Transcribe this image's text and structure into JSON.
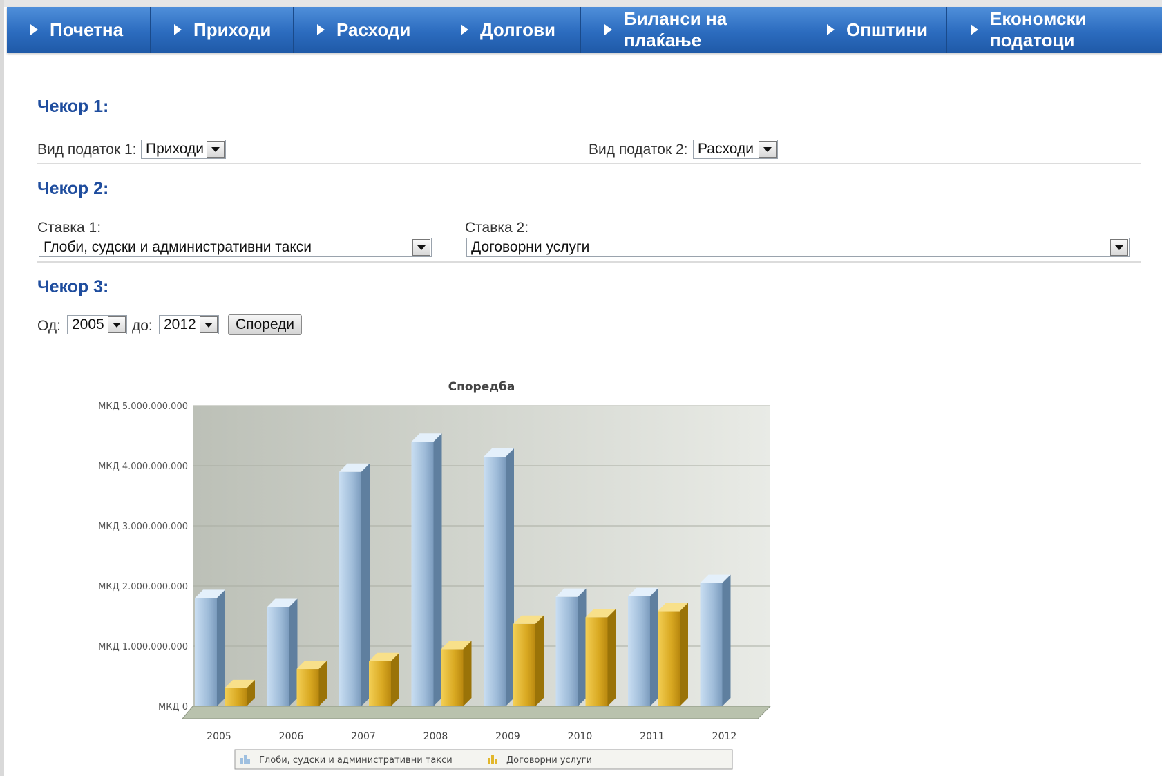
{
  "nav": {
    "items": [
      {
        "label": "Почетна"
      },
      {
        "label": "Приходи"
      },
      {
        "label": "Расходи"
      },
      {
        "label": "Долгови"
      },
      {
        "label": "Биланси на плаќање"
      },
      {
        "label": "Општини"
      },
      {
        "label": "Економски податоци"
      }
    ]
  },
  "step1": {
    "title": "Чекор 1:",
    "type1_label": "Вид податок 1:",
    "type1_value": "Приходи",
    "type2_label": "Вид податок 2:",
    "type2_value": "Расходи"
  },
  "step2": {
    "title": "Чекор 2:",
    "item1_label": "Ставка 1:",
    "item1_value": "Глоби, судски и административни такси",
    "item2_label": "Ставка 2:",
    "item2_value": "Договорни услуги"
  },
  "step3": {
    "title": "Чекор 3:",
    "from_label": "Од:",
    "from_value": "2005",
    "to_label": "до:",
    "to_value": "2012",
    "compare_button": "Спореди"
  },
  "colors": {
    "nav": "#2c6cbf",
    "step_title": "#1f4d9e",
    "series1": "#9fc0e0",
    "series2": "#e2b72c"
  },
  "chart_data": {
    "type": "bar",
    "title": "Споредба",
    "xlabel": "",
    "ylabel": "",
    "categories": [
      "2005",
      "2006",
      "2007",
      "2008",
      "2009",
      "2010",
      "2011",
      "2012"
    ],
    "series": [
      {
        "name": "Глоби, судски и административни такси",
        "values": [
          1800000000,
          1650000000,
          3900000000,
          4400000000,
          4150000000,
          1820000000,
          1830000000,
          2050000000
        ]
      },
      {
        "name": "Договорни услуги",
        "values": [
          300000000,
          620000000,
          750000000,
          950000000,
          1370000000,
          1480000000,
          1580000000
        ]
      }
    ],
    "ylim": [
      0,
      5000000000
    ],
    "yticks": [
      "МКД 0",
      "МКД 1.000.000.000",
      "МКД 2.000.000.000",
      "МКД 3.000.000.000",
      "МКД 4.000.000.000",
      "МКД 5.000.000.000"
    ],
    "grid": true,
    "legend": "bottom"
  }
}
